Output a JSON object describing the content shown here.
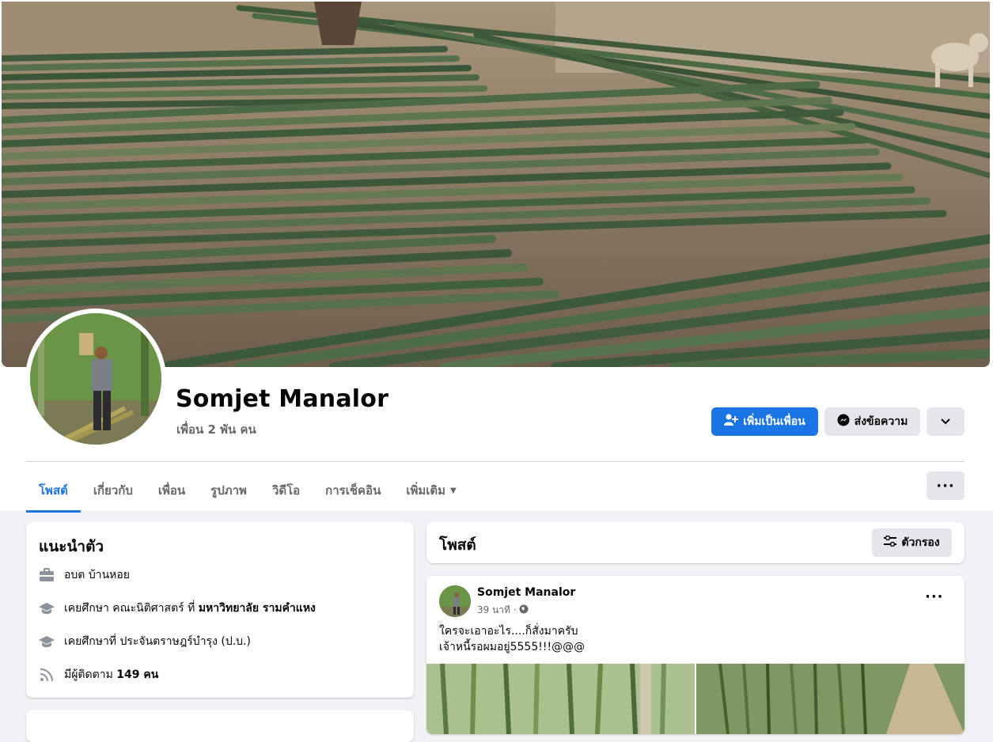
{
  "profile": {
    "name": "Somjet Manalor",
    "friends_count": "เพื่อน 2 พัน คน"
  },
  "actions": {
    "add_friend": "เพิ่มเป็นเพื่อน",
    "message": "ส่งข้อความ"
  },
  "tabs": [
    {
      "label": "โพสต์",
      "active": true
    },
    {
      "label": "เกี่ยวกับ"
    },
    {
      "label": "เพื่อน"
    },
    {
      "label": "รูปภาพ"
    },
    {
      "label": "วิดีโอ"
    },
    {
      "label": "การเช็คอิน"
    },
    {
      "label": "เพิ่มเติม"
    }
  ],
  "intro": {
    "title": "แนะนำตัว",
    "work": "อบต บ้านหอย",
    "education1_prefix": "เคยศึกษา คณะนิติศาสตร์ ที่ ",
    "education1_school": "มหาวิทยาลัย รามคำแหง",
    "education2": "เคยศึกษาที่ ประจันตราษฎร์บำรุง (ป.บ.)",
    "followers_prefix": "มีผู้ติดตาม ",
    "followers_count": "149 คน"
  },
  "posts_header": {
    "title": "โพสต์",
    "filter": "ตัวกรอง"
  },
  "post": {
    "author": "Somjet Manalor",
    "time": "39 นาที ·",
    "line1": "ใครจะเอาอะไร....ก็สั่งมาครับ",
    "line2": "เจ้าหนี้รอผมอยู่5555!!!@@@"
  },
  "colors": {
    "accent": "#1b74e4",
    "secondary_text": "#65676b",
    "background": "#f0f2f5"
  }
}
